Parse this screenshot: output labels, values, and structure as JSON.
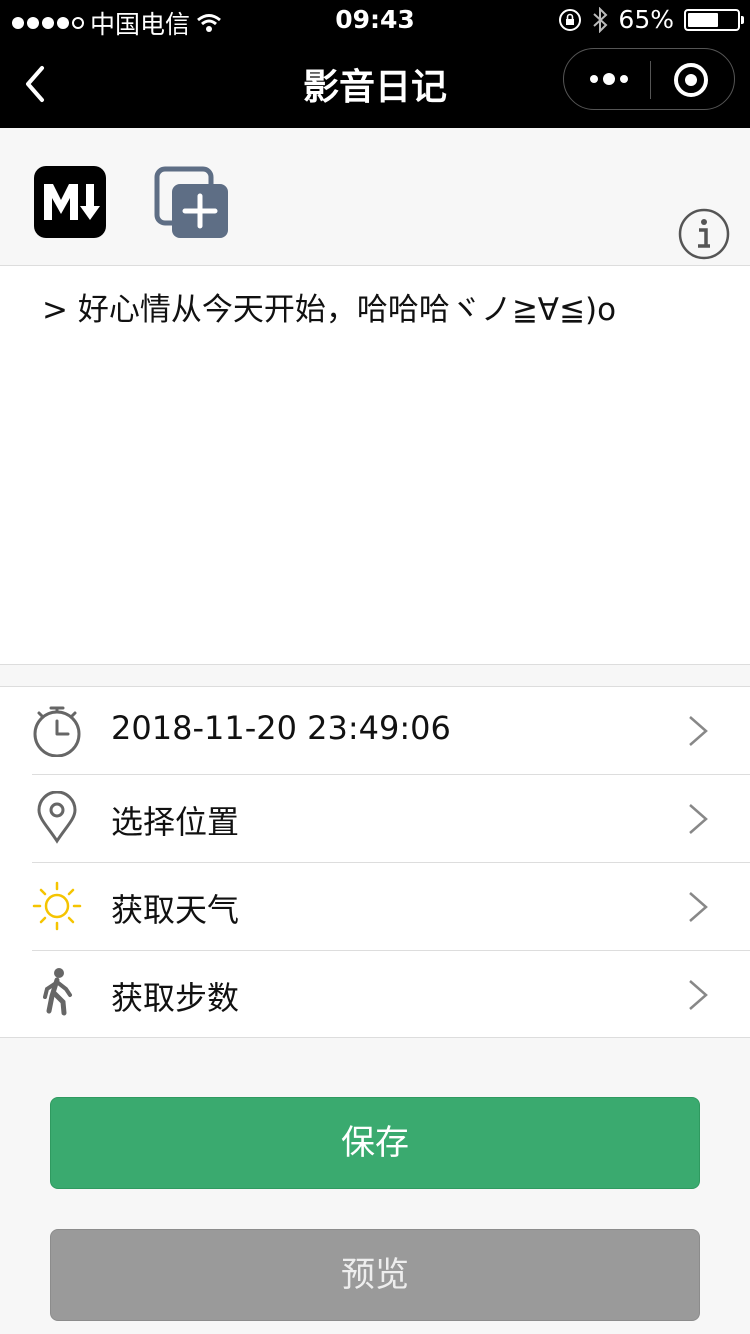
{
  "status_bar": {
    "carrier": "中国电信",
    "time": "09:43",
    "battery": "65%",
    "battery_level": 0.65,
    "icons": [
      "signal-dots-icon",
      "wifi-icon",
      "rotation-lock-icon",
      "bluetooth-icon",
      "battery-icon"
    ]
  },
  "navbar": {
    "title": "影音日记",
    "icons": [
      "back-icon",
      "more-icon",
      "close-target-icon"
    ]
  },
  "toolbar": {
    "icons": [
      "markdown-icon",
      "copy-add-icon",
      "info-icon"
    ]
  },
  "editor": {
    "content": "> 好心情从今天开始，哈哈哈ヾノ≧∀≦)o"
  },
  "list": {
    "items": [
      {
        "icon": "stopwatch-icon",
        "label": "2018-11-20 23:49:06"
      },
      {
        "icon": "location-pin-icon",
        "label": "选择位置"
      },
      {
        "icon": "sun-icon",
        "label": "获取天气"
      },
      {
        "icon": "walking-person-icon",
        "label": "获取步数"
      }
    ]
  },
  "buttons": {
    "save": "保存",
    "preview": "预览"
  },
  "colors": {
    "save_green": "#3aaa6f",
    "preview_gray": "#9a9a9a",
    "sun_yellow": "#f5c400",
    "icon_gray": "#666666"
  }
}
